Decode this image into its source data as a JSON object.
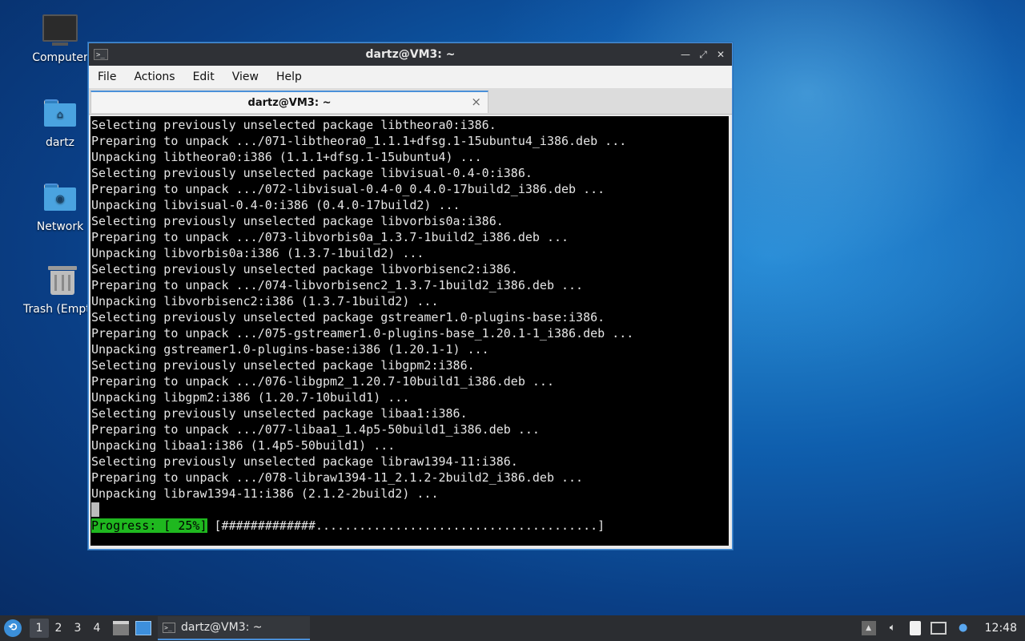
{
  "desktop": {
    "icons": [
      {
        "label": "Computer"
      },
      {
        "label": "dartz"
      },
      {
        "label": "Network"
      },
      {
        "label": "Trash (Empty)"
      }
    ]
  },
  "window": {
    "title": "dartz@VM3: ~",
    "menu": [
      "File",
      "Actions",
      "Edit",
      "View",
      "Help"
    ],
    "tab_label": "dartz@VM3: ~",
    "tab_close": "×",
    "terminal_lines": [
      "Selecting previously unselected package libtheora0:i386.",
      "Preparing to unpack .../071-libtheora0_1.1.1+dfsg.1-15ubuntu4_i386.deb ...",
      "Unpacking libtheora0:i386 (1.1.1+dfsg.1-15ubuntu4) ...",
      "Selecting previously unselected package libvisual-0.4-0:i386.",
      "Preparing to unpack .../072-libvisual-0.4-0_0.4.0-17build2_i386.deb ...",
      "Unpacking libvisual-0.4-0:i386 (0.4.0-17build2) ...",
      "Selecting previously unselected package libvorbis0a:i386.",
      "Preparing to unpack .../073-libvorbis0a_1.3.7-1build2_i386.deb ...",
      "Unpacking libvorbis0a:i386 (1.3.7-1build2) ...",
      "Selecting previously unselected package libvorbisenc2:i386.",
      "Preparing to unpack .../074-libvorbisenc2_1.3.7-1build2_i386.deb ...",
      "Unpacking libvorbisenc2:i386 (1.3.7-1build2) ...",
      "Selecting previously unselected package gstreamer1.0-plugins-base:i386.",
      "Preparing to unpack .../075-gstreamer1.0-plugins-base_1.20.1-1_i386.deb ...",
      "Unpacking gstreamer1.0-plugins-base:i386 (1.20.1-1) ...",
      "Selecting previously unselected package libgpm2:i386.",
      "Preparing to unpack .../076-libgpm2_1.20.7-10build1_i386.deb ...",
      "Unpacking libgpm2:i386 (1.20.7-10build1) ...",
      "Selecting previously unselected package libaa1:i386.",
      "Preparing to unpack .../077-libaa1_1.4p5-50build1_i386.deb ...",
      "Unpacking libaa1:i386 (1.4p5-50build1) ...",
      "Selecting previously unselected package libraw1394-11:i386.",
      "Preparing to unpack .../078-libraw1394-11_2.1.2-2build2_i386.deb ...",
      "Unpacking libraw1394-11:i386 (2.1.2-2build2) ..."
    ],
    "progress": {
      "label": "Progress: [ 25%]",
      "bar": " [#############.......................................]",
      "percent": 25
    }
  },
  "taskbar": {
    "workspaces": [
      "1",
      "2",
      "3",
      "4"
    ],
    "active_workspace": "1",
    "task_label": "dartz@VM3: ~",
    "clock": "12:48"
  },
  "colors": {
    "accent": "#4a90d9",
    "progress_green": "#1fb81f",
    "terminal_bg": "#000000",
    "titlebar_bg": "#2f3136"
  }
}
